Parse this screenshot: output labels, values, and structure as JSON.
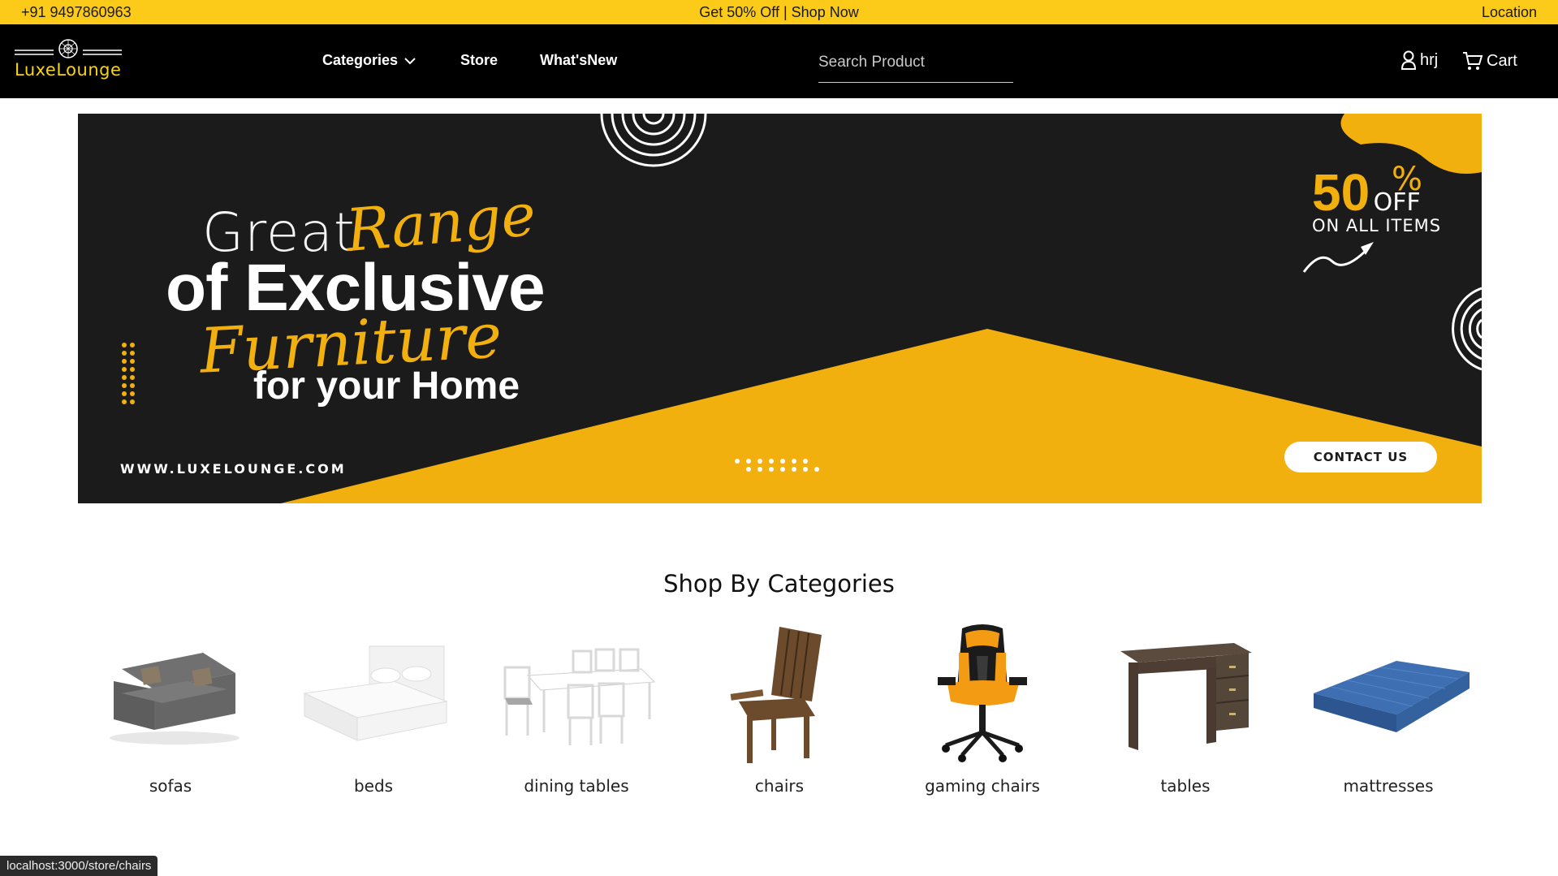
{
  "topbar": {
    "phone": "+91 9497860963",
    "promo": "Get 50% Off | Shop Now",
    "location": "Location"
  },
  "nav": {
    "logo": "LuxeLounge",
    "links": [
      "Categories",
      "Store",
      "What'sNew"
    ],
    "search_placeholder": "Search Product",
    "user": "hrj",
    "cart": "Cart"
  },
  "banner": {
    "line1": "Great",
    "line1_script": "Range",
    "line2": "of Exclusive",
    "line3_script": "Furniture",
    "line4": "for your Home",
    "url": "WWW.LUXELOUNGE.COM",
    "offer_value": "50",
    "offer_percent": "%",
    "offer_off": "OFF",
    "offer_items": "ON ALL ITEMS",
    "contact_label": "CONTACT US"
  },
  "categories": {
    "title": "Shop By Categories",
    "items": [
      "sofas",
      "beds",
      "dining tables",
      "chairs",
      "gaming chairs",
      "tables",
      "mattresses"
    ]
  },
  "status": "localhost:3000/store/chairs",
  "colors": {
    "brand_yellow": "#fcca18",
    "nav_black": "#000000",
    "banner_yellow": "#f2b00f"
  }
}
